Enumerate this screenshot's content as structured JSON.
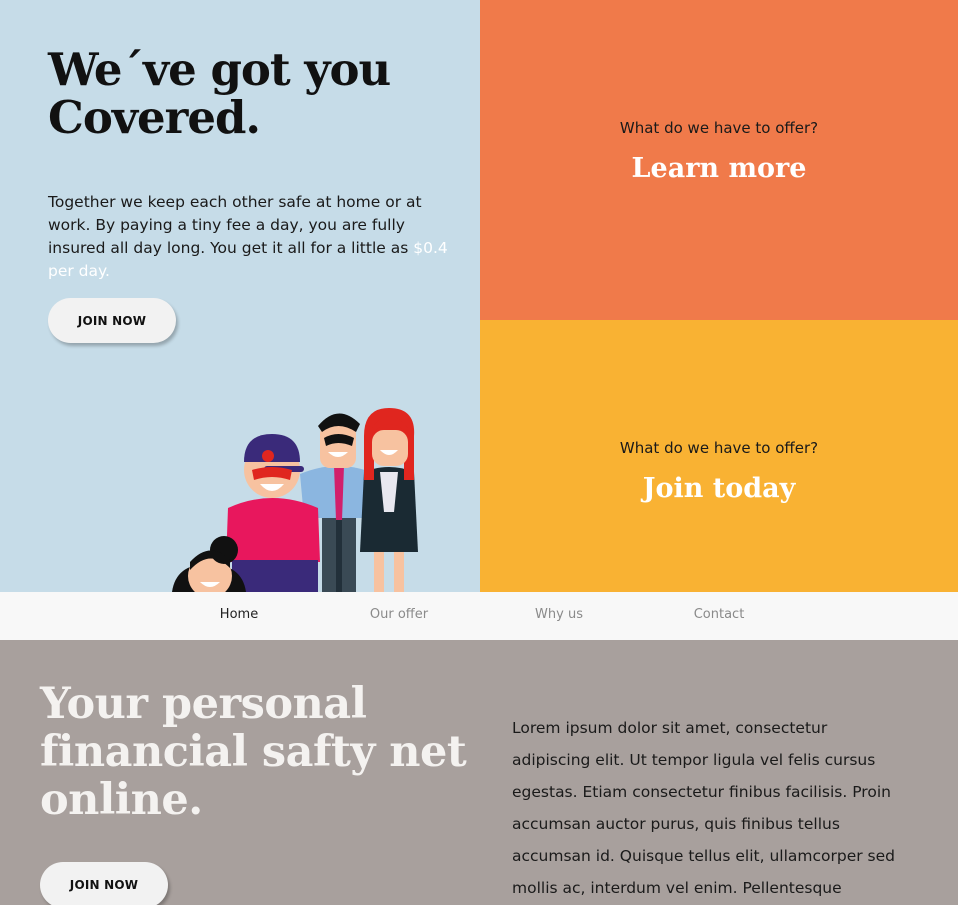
{
  "hero": {
    "title_line1": "We´ve got you",
    "title_line2": "Covered.",
    "text": "Together we keep each other safe at home or at work. By paying a tiny fee a day, you are fully insured all day long. You get it all for a little as ",
    "text_highlight": "$0.4 per day.",
    "button_label": "JOIN NOW"
  },
  "tiles": [
    {
      "question": "What do we have to offer?",
      "link_label": "Learn more",
      "color": "#f07a4a"
    },
    {
      "question": "What do we have to offer?",
      "link_label": "Join today",
      "color": "#f9b233"
    }
  ],
  "nav": {
    "items": [
      {
        "label": "Home",
        "active": true
      },
      {
        "label": "Our offer",
        "active": false
      },
      {
        "label": "Why us",
        "active": false
      },
      {
        "label": "Contact",
        "active": false
      }
    ]
  },
  "section": {
    "title_line1": "Your personal",
    "title_line2": "financial safty net",
    "title_line3": "online.",
    "button_label": "JOIN NOW",
    "body": "Lorem ipsum dolor sit amet, consectetur adipiscing elit. Ut tempor ligula vel felis cursus egestas. Etiam consectetur finibus facilisis. Proin accumsan auctor purus, quis finibus tellus accumsan id. Quisque tellus elit, ullamcorper sed mollis ac, interdum vel enim. Pellentesque congue felis eget lorem tempor"
  },
  "colors": {
    "hero_bg": "#c6dce8",
    "nav_bg": "#f8f8f8",
    "section_bg": "#a8a09d"
  }
}
